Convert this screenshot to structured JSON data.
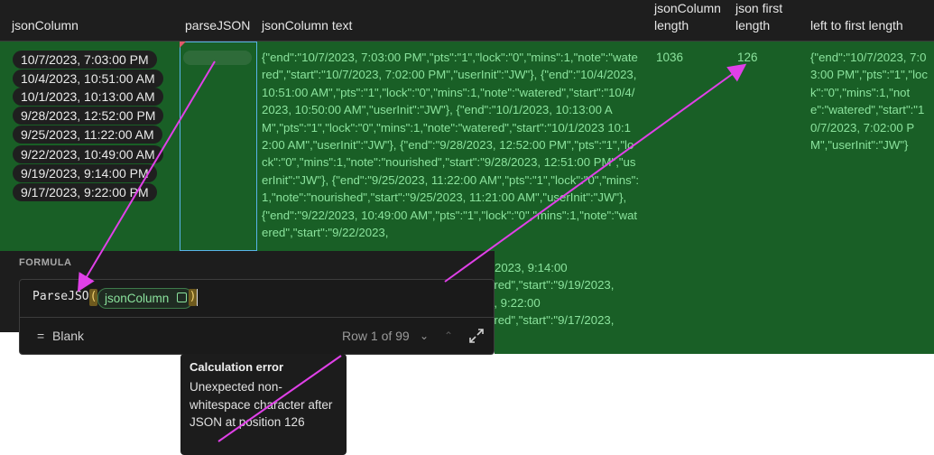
{
  "header": {
    "columns": [
      {
        "label": "jsonColumn"
      },
      {
        "label": "parseJSON"
      },
      {
        "label": "jsonColumn text"
      },
      {
        "label": "jsonColumn\nlength",
        "line1": "jsonColumn",
        "line2": "length"
      },
      {
        "label": "json first\nlength",
        "line1": "json first",
        "line2": "length"
      },
      {
        "label": "left to first length"
      }
    ]
  },
  "row": {
    "dates": [
      "10/7/2023, 7:03:00 PM",
      "10/4/2023, 10:51:00 AM",
      "10/1/2023, 10:13:00 AM",
      "9/28/2023, 12:52:00 PM",
      "9/25/2023, 11:22:00 AM",
      "9/22/2023, 10:49:00 AM",
      "9/19/2023, 9:14:00 PM",
      "9/17/2023, 9:22:00 PM"
    ],
    "json_text": "{\"end\":\"10/7/2023, 7:03:00 PM\",\"pts\":\"1\",\"lock\":\"0\",\"mins\":1,\"note\":\"watered\",\"start\":\"10/7/2023, 7:02:00 PM\",\"userInit\":\"JW\"}, {\"end\":\"10/4/2023, 10:51:00 AM\",\"pts\":\"1\",\"lock\":\"0\",\"mins\":1,\"note\":\"watered\",\"start\":\"10/4/2023, 10:50:00 AM\",\"userInit\":\"JW\"}, {\"end\":\"10/1/2023, 10:13:00 AM\",\"pts\":\"1\",\"lock\":\"0\",\"mins\":1,\"note\":\"watered\",\"start\":\"10/1/2023 10:12:00 AM\",\"userInit\":\"JW\"}, {\"end\":\"9/28/2023, 12:52:00 PM\",\"pts\":\"1\",\"lock\":\"0\",\"mins\":1,\"note\":\"nourished\",\"start\":\"9/28/2023, 12:51:00 PM\",\"userInit\":\"JW\"}, {\"end\":\"9/25/2023, 11:22:00 AM\",\"pts\":\"1\",\"lock\":\"0\",\"mins\":1,\"note\":\"nourished\",\"start\":\"9/25/2023, 11:21:00 AM\",\"userInit\":\"JW\"}, {\"end\":\"9/22/2023, 10:49:00 AM\",\"pts\":\"1\",\"lock\":\"0\",\"mins\":1,\"note\":\"watered\",\"start\":\"9/22/2023,",
    "json_tail_lines": [
      "AM\",\"userInit\":\"JW\"}, {\"end\":\"9/19/2023, 9:14:00",
      "ered\",\"start\":\"9/19/2023,",
      "3, 9:22:00",
      "ered\",\"start\":\"9/17/2023,"
    ],
    "length": "1036",
    "first_length": "126",
    "left_to_first": "{\"end\":\"10/7/2023, 7:03:00 PM\",\"pts\":\"1\",\"lock\":\"0\",\"mins\":1,\"note\":\"watered\",\"start\":\"10/7/2023, 7:02:00 PM\",\"userInit\":\"JW\"}"
  },
  "formula": {
    "label": "FORMULA",
    "function": "ParseJSON",
    "open_paren": "(",
    "close_paren": ")",
    "argument": "jsonColumn",
    "result_eq": "=",
    "result": "Blank",
    "row_nav": "Row 1 of 99"
  },
  "tooltip": {
    "title": "Calculation error",
    "body": "Unexpected non-whitespace character after JSON at position 126"
  },
  "colors": {
    "row_bg": "#195f26",
    "text_green": "#8be39d",
    "arrow": "#e040e8",
    "selection": "#58b4e8"
  }
}
